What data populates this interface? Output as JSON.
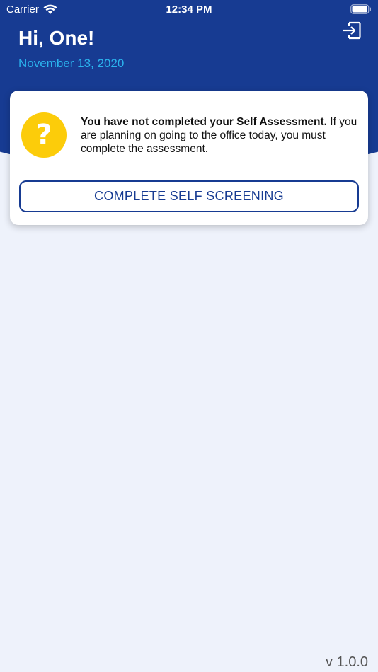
{
  "status_bar": {
    "carrier": "Carrier",
    "time": "12:34 PM"
  },
  "header": {
    "greeting": "Hi, One!",
    "date": "November 13, 2020",
    "logout_icon": "logout-icon"
  },
  "card": {
    "icon": "question-icon",
    "icon_glyph": "?",
    "message_bold": "You have not completed your Self Assessment.",
    "message_rest": " If you are planning on going to the office today, you must complete the assessment.",
    "button_label": "COMPLETE SELF SCREENING"
  },
  "footer": {
    "version": "v 1.0.0"
  },
  "colors": {
    "header_blue": "#173b92",
    "date_cyan": "#2bb4ee",
    "warning_yellow": "#fccc0a",
    "background": "#eef2fb"
  }
}
